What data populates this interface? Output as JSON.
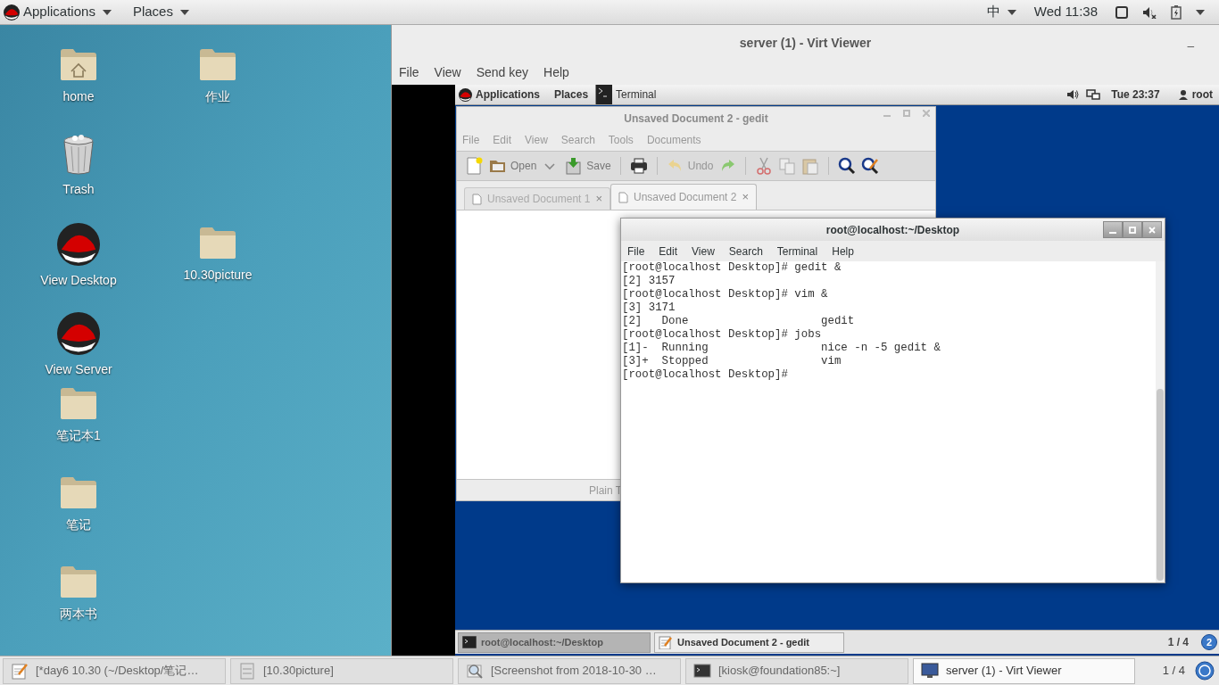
{
  "top_bar": {
    "applications": "Applications",
    "places": "Places",
    "input_method": "中",
    "clock": "Wed 11:38"
  },
  "desktop_icons": [
    {
      "kind": "home",
      "label": "home"
    },
    {
      "kind": "folder",
      "label": "作业"
    },
    {
      "kind": "trash",
      "label": "Trash"
    },
    {
      "kind": "redhat",
      "label": "View Desktop"
    },
    {
      "kind": "folder",
      "label": "10.30picture"
    },
    {
      "kind": "redhat",
      "label": "View Server"
    },
    {
      "kind": "folder",
      "label": "笔记本1"
    },
    {
      "kind": "folder",
      "label": "笔记"
    },
    {
      "kind": "folder",
      "label": "两本书"
    }
  ],
  "viewer": {
    "title": "server (1) - Virt Viewer",
    "minimize": "_",
    "menu": [
      "File",
      "View",
      "Send key",
      "Help"
    ],
    "guest": {
      "top_bar": {
        "applications": "Applications",
        "places": "Places",
        "task": "Terminal",
        "clock": "Tue 23:37",
        "user": "root"
      },
      "gedit": {
        "title": "Unsaved Document 2 - gedit",
        "menu": [
          "File",
          "Edit",
          "View",
          "Search",
          "Tools",
          "Documents"
        ],
        "toolbar": [
          {
            "kind": "new",
            "disabled": false
          },
          {
            "kind": "open",
            "label": "Open",
            "disabled": false
          },
          {
            "kind": "dropdown",
            "disabled": false
          },
          {
            "kind": "save",
            "label": "Save",
            "disabled": false
          },
          {
            "kind": "print",
            "disabled": false
          },
          {
            "kind": "undo",
            "label": "Undo",
            "disabled": true
          },
          {
            "kind": "redo",
            "disabled": false
          },
          {
            "kind": "cut",
            "disabled": true
          },
          {
            "kind": "copy",
            "disabled": true
          },
          {
            "kind": "paste",
            "disabled": true
          },
          {
            "kind": "find",
            "disabled": false
          },
          {
            "kind": "replace",
            "disabled": false
          }
        ],
        "tabs": [
          {
            "label": "Unsaved Document 1",
            "close": "×",
            "selected": false
          },
          {
            "label": "Unsaved Document 2",
            "close": "×",
            "selected": true
          }
        ],
        "status": "Plain T"
      },
      "terminal": {
        "title": "root@localhost:~/Desktop",
        "menu": [
          "File",
          "Edit",
          "View",
          "Search",
          "Terminal",
          "Help"
        ],
        "lines": [
          "[root@localhost Desktop]# gedit &",
          "[2] 3157",
          "[root@localhost Desktop]# vim &",
          "[3] 3171",
          "[2]   Done                    gedit",
          "[root@localhost Desktop]# jobs",
          "[1]-  Running                 nice -n -5 gedit &",
          "[3]+  Stopped                 vim",
          "[root@localhost Desktop]#"
        ]
      },
      "taskbar": {
        "items": [
          {
            "kind": "terminal",
            "label": "root@localhost:~/Desktop",
            "selected": true
          },
          {
            "kind": "editor",
            "label": "Unsaved Document 2 - gedit",
            "selected": false
          }
        ],
        "pager": "1 / 4",
        "badge": "2"
      }
    }
  },
  "taskbar": {
    "items": [
      {
        "kind": "editor",
        "label": "[*day6 10.30 (~/Desktop/笔记…",
        "selected": false
      },
      {
        "kind": "folder",
        "label": "[10.30picture]",
        "selected": false
      },
      {
        "kind": "image",
        "label": "[Screenshot from 2018-10-30 …",
        "selected": false
      },
      {
        "kind": "terminal",
        "label": "[kiosk@foundation85:~]",
        "selected": false
      },
      {
        "kind": "monitor",
        "label": "server (1) - Virt Viewer",
        "selected": true
      }
    ],
    "pager": "1 / 4"
  }
}
